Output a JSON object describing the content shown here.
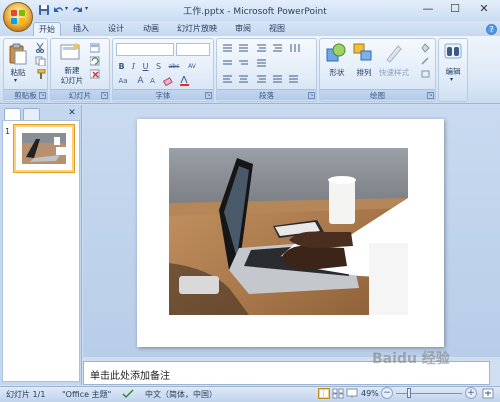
{
  "window": {
    "title": "工作.pptx - Microsoft PowerPoint",
    "minimize": "—",
    "maximize": "☐",
    "close": "✕"
  },
  "tabs": [
    "开始",
    "插入",
    "设计",
    "动画",
    "幻灯片放映",
    "审阅",
    "视图"
  ],
  "active_tab": "开始",
  "help": "?",
  "ribbon": {
    "clipboard": {
      "label": "剪贴板",
      "paste": "粘贴"
    },
    "slides": {
      "label": "幻灯片",
      "new_slide": "新建",
      "new_slide2": "幻灯片"
    },
    "font": {
      "label": "字体",
      "bold": "B",
      "italic": "I",
      "underline": "U",
      "shadow": "S",
      "strike": "abc",
      "spacing": "AV",
      "case": "Aa",
      "grow": "A",
      "shrink": "A"
    },
    "paragraph": {
      "label": "段落"
    },
    "drawing": {
      "label": "绘图",
      "shapes": "形状",
      "arrange": "排列",
      "quick_styles": "快速样式"
    },
    "editing": {
      "label": "编辑"
    }
  },
  "panel": {
    "close": "✕",
    "slide_number": "1"
  },
  "notes": {
    "placeholder": "单击此处添加备注"
  },
  "status": {
    "slide_info": "幻灯片 1/1",
    "theme": "\"Office 主题\"",
    "language": "中文（简体，中国）",
    "zoom": "49%"
  },
  "watermark": "Baidu 经验",
  "colors": {
    "accent": "#1e395b",
    "ribbon_bg": "#dbe7f6",
    "selection": "#ffd07a"
  }
}
